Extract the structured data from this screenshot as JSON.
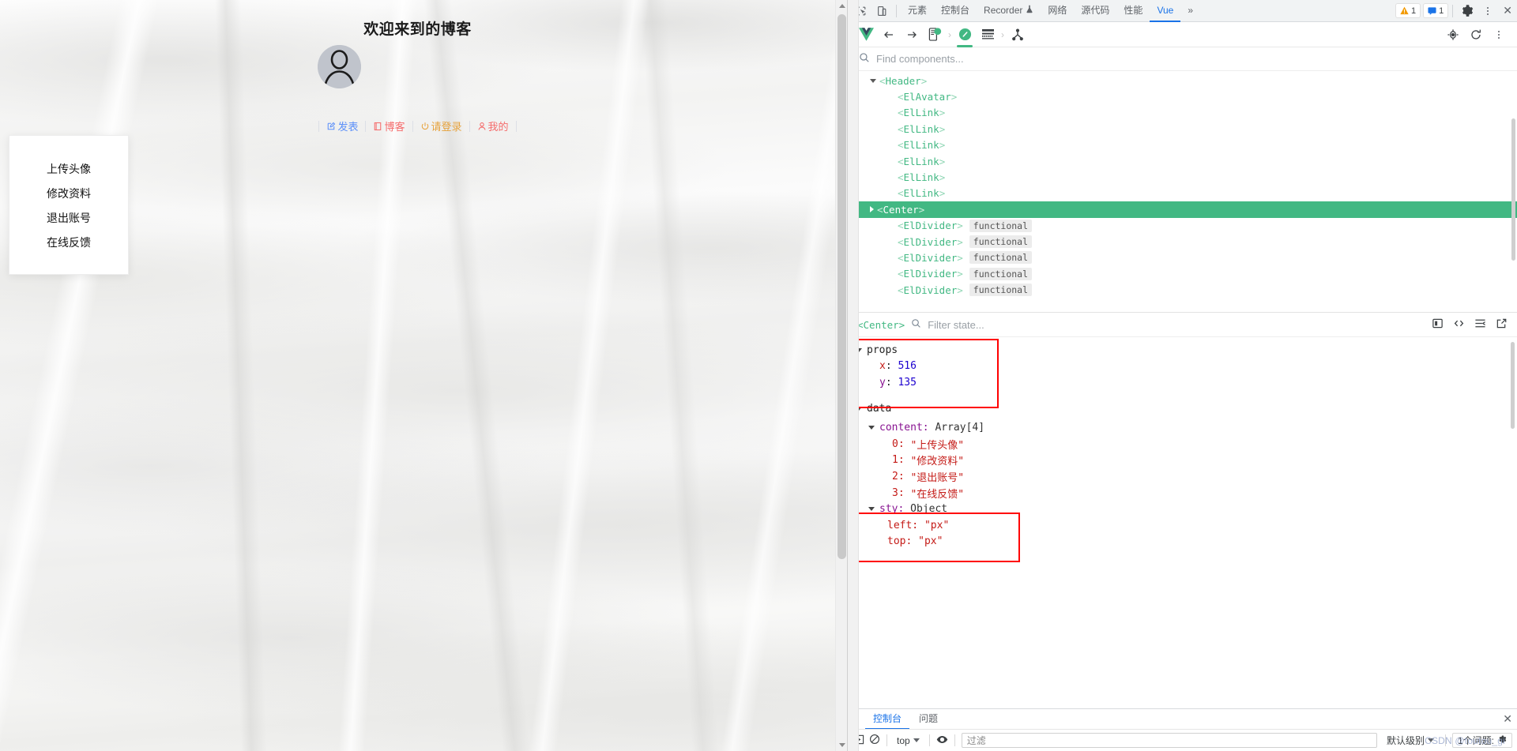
{
  "page": {
    "title": "欢迎来到的博客",
    "avatar_icon": "user-avatar-icon",
    "nav": [
      {
        "label": "发表",
        "icon": "edit-square-icon",
        "color": "#5b8ff9"
      },
      {
        "label": "博客",
        "icon": "document-icon",
        "color": "#f56c6c"
      },
      {
        "label": "请登录",
        "icon": "power-switch-icon",
        "color": "#e6a23c"
      },
      {
        "label": "我的",
        "icon": "user-icon",
        "color": "#f56c6c"
      }
    ],
    "dropdown": {
      "items": [
        "上传头像",
        "修改资料",
        "退出账号",
        "在线反馈"
      ]
    }
  },
  "devtools": {
    "topbar": {
      "inspect_icon": "cursor-select-icon",
      "device_icon": "device-toggle-icon",
      "tabs": [
        {
          "label": "元素",
          "active": false
        },
        {
          "label": "控制台",
          "active": false
        },
        {
          "label": "Recorder",
          "active": false,
          "suffix_icon": "flask-icon"
        },
        {
          "label": "网络",
          "active": false
        },
        {
          "label": "源代码",
          "active": false
        },
        {
          "label": "性能",
          "active": false
        },
        {
          "label": "Vue",
          "active": true
        }
      ],
      "overflow_label": "»",
      "warning_count": "1",
      "message_count": "1",
      "settings_icon": "gear-icon",
      "more_icon": "kebab-menu-icon",
      "close_icon": "close-icon"
    },
    "vue_toolbar": {
      "logo_icon": "vue-logo-icon",
      "back_icon": "arrow-left-icon",
      "forward_icon": "arrow-right-icon",
      "app_icon": "app-badge-icon",
      "components_icon": "vue-components-icon",
      "timeline_icon": "timeline-icon",
      "routes_icon": "routes-tree-icon",
      "target_icon": "select-target-icon",
      "refresh_icon": "refresh-icon",
      "menu_icon": "kebab-menu-icon"
    },
    "search": {
      "icon": "search-icon",
      "placeholder": "Find components...",
      "value": ""
    },
    "tree": [
      {
        "label": "<Header>",
        "indent": 1,
        "caret": "open",
        "selected": false,
        "chip": ""
      },
      {
        "label": "<ElAvatar>",
        "indent": 2,
        "caret": "none",
        "selected": false,
        "chip": ""
      },
      {
        "label": "<ElLink>",
        "indent": 2,
        "caret": "none",
        "selected": false,
        "chip": ""
      },
      {
        "label": "<ElLink>",
        "indent": 2,
        "caret": "none",
        "selected": false,
        "chip": ""
      },
      {
        "label": "<ElLink>",
        "indent": 2,
        "caret": "none",
        "selected": false,
        "chip": ""
      },
      {
        "label": "<ElLink>",
        "indent": 2,
        "caret": "none",
        "selected": false,
        "chip": ""
      },
      {
        "label": "<ElLink>",
        "indent": 2,
        "caret": "none",
        "selected": false,
        "chip": ""
      },
      {
        "label": "<ElLink>",
        "indent": 2,
        "caret": "none",
        "selected": false,
        "chip": ""
      },
      {
        "label": "<Center>",
        "indent": 1,
        "caret": "closed",
        "selected": true,
        "chip": ""
      },
      {
        "label": "<ElDivider>",
        "indent": 2,
        "caret": "none",
        "selected": false,
        "chip": "functional"
      },
      {
        "label": "<ElDivider>",
        "indent": 2,
        "caret": "none",
        "selected": false,
        "chip": "functional"
      },
      {
        "label": "<ElDivider>",
        "indent": 2,
        "caret": "none",
        "selected": false,
        "chip": "functional"
      },
      {
        "label": "<ElDivider>",
        "indent": 2,
        "caret": "none",
        "selected": false,
        "chip": "functional"
      },
      {
        "label": "<ElDivider>",
        "indent": 2,
        "caret": "none",
        "selected": false,
        "chip": "functional"
      }
    ],
    "inspector": {
      "component_name": "<Center>",
      "filter_icon": "search-icon",
      "filter_placeholder": "Filter state...",
      "filter_value": "",
      "actions": [
        {
          "icon": "scroll-into-view-icon"
        },
        {
          "icon": "open-in-editor-icon"
        },
        {
          "icon": "collapse-all-icon"
        },
        {
          "icon": "open-external-icon"
        }
      ]
    },
    "state": {
      "props_label": "props",
      "props": [
        {
          "key": "x",
          "value": "516"
        },
        {
          "key": "y",
          "value": "135"
        }
      ],
      "data_label": "data",
      "content_label": "content:",
      "content_type": "Array[4]",
      "content": [
        {
          "index": "0:",
          "value": "\"上传头像\""
        },
        {
          "index": "1:",
          "value": "\"修改资料\""
        },
        {
          "index": "2:",
          "value": "\"退出账号\""
        },
        {
          "index": "3:",
          "value": "\"在线反馈\""
        }
      ],
      "sty_label": "sty:",
      "sty_type": "Object",
      "sty": [
        {
          "key": "left:",
          "value": "\"px\""
        },
        {
          "key": "top:",
          "value": "\"px\""
        }
      ],
      "highlight_color": "#ff0000"
    },
    "drawer": {
      "menu_icon": "kebab-menu-icon",
      "tabs": [
        {
          "label": "控制台",
          "active": true
        },
        {
          "label": "问题",
          "active": false
        }
      ],
      "close_icon": "close-icon"
    },
    "console_bar": {
      "execute_icon": "execute-icon",
      "clear_icon": "clear-console-icon",
      "context": "top",
      "eye_icon": "live-expression-icon",
      "filter_placeholder": "过滤",
      "filter_value": "",
      "level": "默认级别",
      "issues": "1个问题:",
      "issues_icon": "issue-gear-icon",
      "watermark": "CSDN @toutou_gi"
    }
  }
}
